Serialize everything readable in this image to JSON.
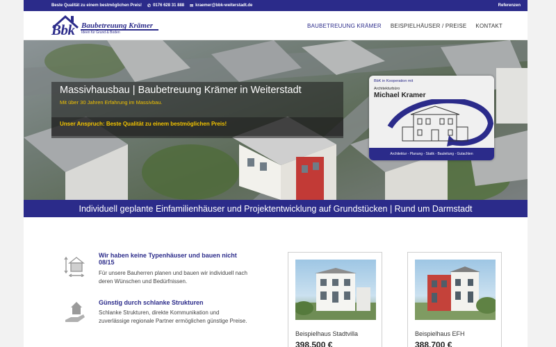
{
  "topbar": {
    "slogan": "Beste Qualität zu einem bestmöglichen Preis!",
    "phone": "0176 628 31 888",
    "email": "kraemer@bbk-weiterstadt.de",
    "references": "Referenzen"
  },
  "logo": {
    "short": "Bbk",
    "name": "Baubetreuung Krämer",
    "tagline": "Ideen für Grund & Boden"
  },
  "nav": {
    "items": [
      {
        "label": "BAUBETREUUNG KRÄMER",
        "active": true
      },
      {
        "label": "BEISPIELHÄUSER / PREISE",
        "active": false
      },
      {
        "label": "KONTAKT",
        "active": false
      }
    ]
  },
  "hero": {
    "title": "Massivhausbau | Baubetreuung Krämer in Weiterstadt",
    "subtitle": "Mit über 30 Jahren Erfahrung im Massivbau.",
    "claim": "Unser Anspruch: Beste Qualität zu einem bestmöglichen Preis!",
    "band": "Individuell geplante Einfamilienhäuser und Projektentwicklung auf Grundstücken | Rund um Darmstadt"
  },
  "badge": {
    "cooperation": "BbK in Kooperation mit",
    "office": "Architekturbüro",
    "architect": "Michael Kramer",
    "services": "Architektur - Planung - Statik - Bauleitung - Gutachten"
  },
  "features": [
    {
      "icon": "house-measure-icon",
      "title": "Wir haben keine Typenhäuser und bauen nicht 08/15",
      "text": "Für unsere Bauherren planen und bauen wir individuell nach deren Wünschen und Bedürfnissen."
    },
    {
      "icon": "house-hand-icon",
      "title": "Günstig durch schlanke Strukturen",
      "text": "Schlanke Strukturen, direkte Kommunikation und zuverlässige regionale Partner ermöglichen günstige Preise."
    }
  ],
  "cards": [
    {
      "name": "Beispielhaus Stadtvilla",
      "price": "398.500 €"
    },
    {
      "name": "Beispielhaus EFH",
      "price": "388.700 €"
    }
  ],
  "colors": {
    "brand": "#2b2b8a",
    "accent": "#f2c300"
  }
}
